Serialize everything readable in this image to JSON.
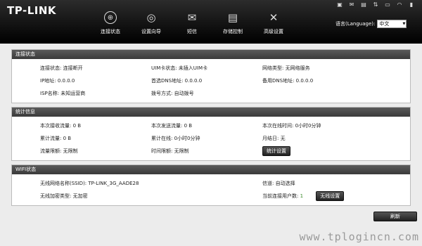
{
  "brand": "TP-LINK",
  "nav": [
    {
      "label": "连接状态",
      "icon": "globe-icon"
    },
    {
      "label": "设置向导",
      "icon": "target-icon"
    },
    {
      "label": "短信",
      "icon": "envelope-icon"
    },
    {
      "label": "存储控制",
      "icon": "sd-card-icon"
    },
    {
      "label": "高级设置",
      "icon": "tools-icon"
    }
  ],
  "language": {
    "label": "语言(Language):",
    "value": "中文"
  },
  "sections": {
    "connection": {
      "title": "连接状态",
      "rows": [
        [
          "连接状态: 连接断开",
          "UIM卡状态: 未插入UIM卡",
          "网络类型: 无网络服务"
        ],
        [
          "IP地址: 0.0.0.0",
          "首选DNS地址: 0.0.0.0",
          "备用DNS地址: 0.0.0.0"
        ],
        [
          "ISP名称: 未知运营商",
          "拨号方式: 自动拨号",
          ""
        ]
      ]
    },
    "stats": {
      "title": "统计信息",
      "rows": [
        [
          "本次接收流量: 0 B",
          "本次发送流量: 0 B",
          "本次在线时间: 0小时0分钟"
        ],
        [
          "累计流量: 0 B",
          "累计在线: 0小时0分钟",
          "月结日: 无"
        ],
        [
          "流量限额: 无限制",
          "时间限额: 无限制",
          ""
        ]
      ],
      "button": "统计设置"
    },
    "wifi": {
      "title": "WIFI状态",
      "ssid": "无线网络名称(SSID): TP-LINK_3G_AADE28",
      "channel": "信道: 自动选择",
      "encryption": "无线加密类型: 无加密",
      "users_label": "当前连接用户数:",
      "users_count": "1",
      "button": "无线设置"
    }
  },
  "refresh": "刷新",
  "watermark": "www.tplogincn.com"
}
